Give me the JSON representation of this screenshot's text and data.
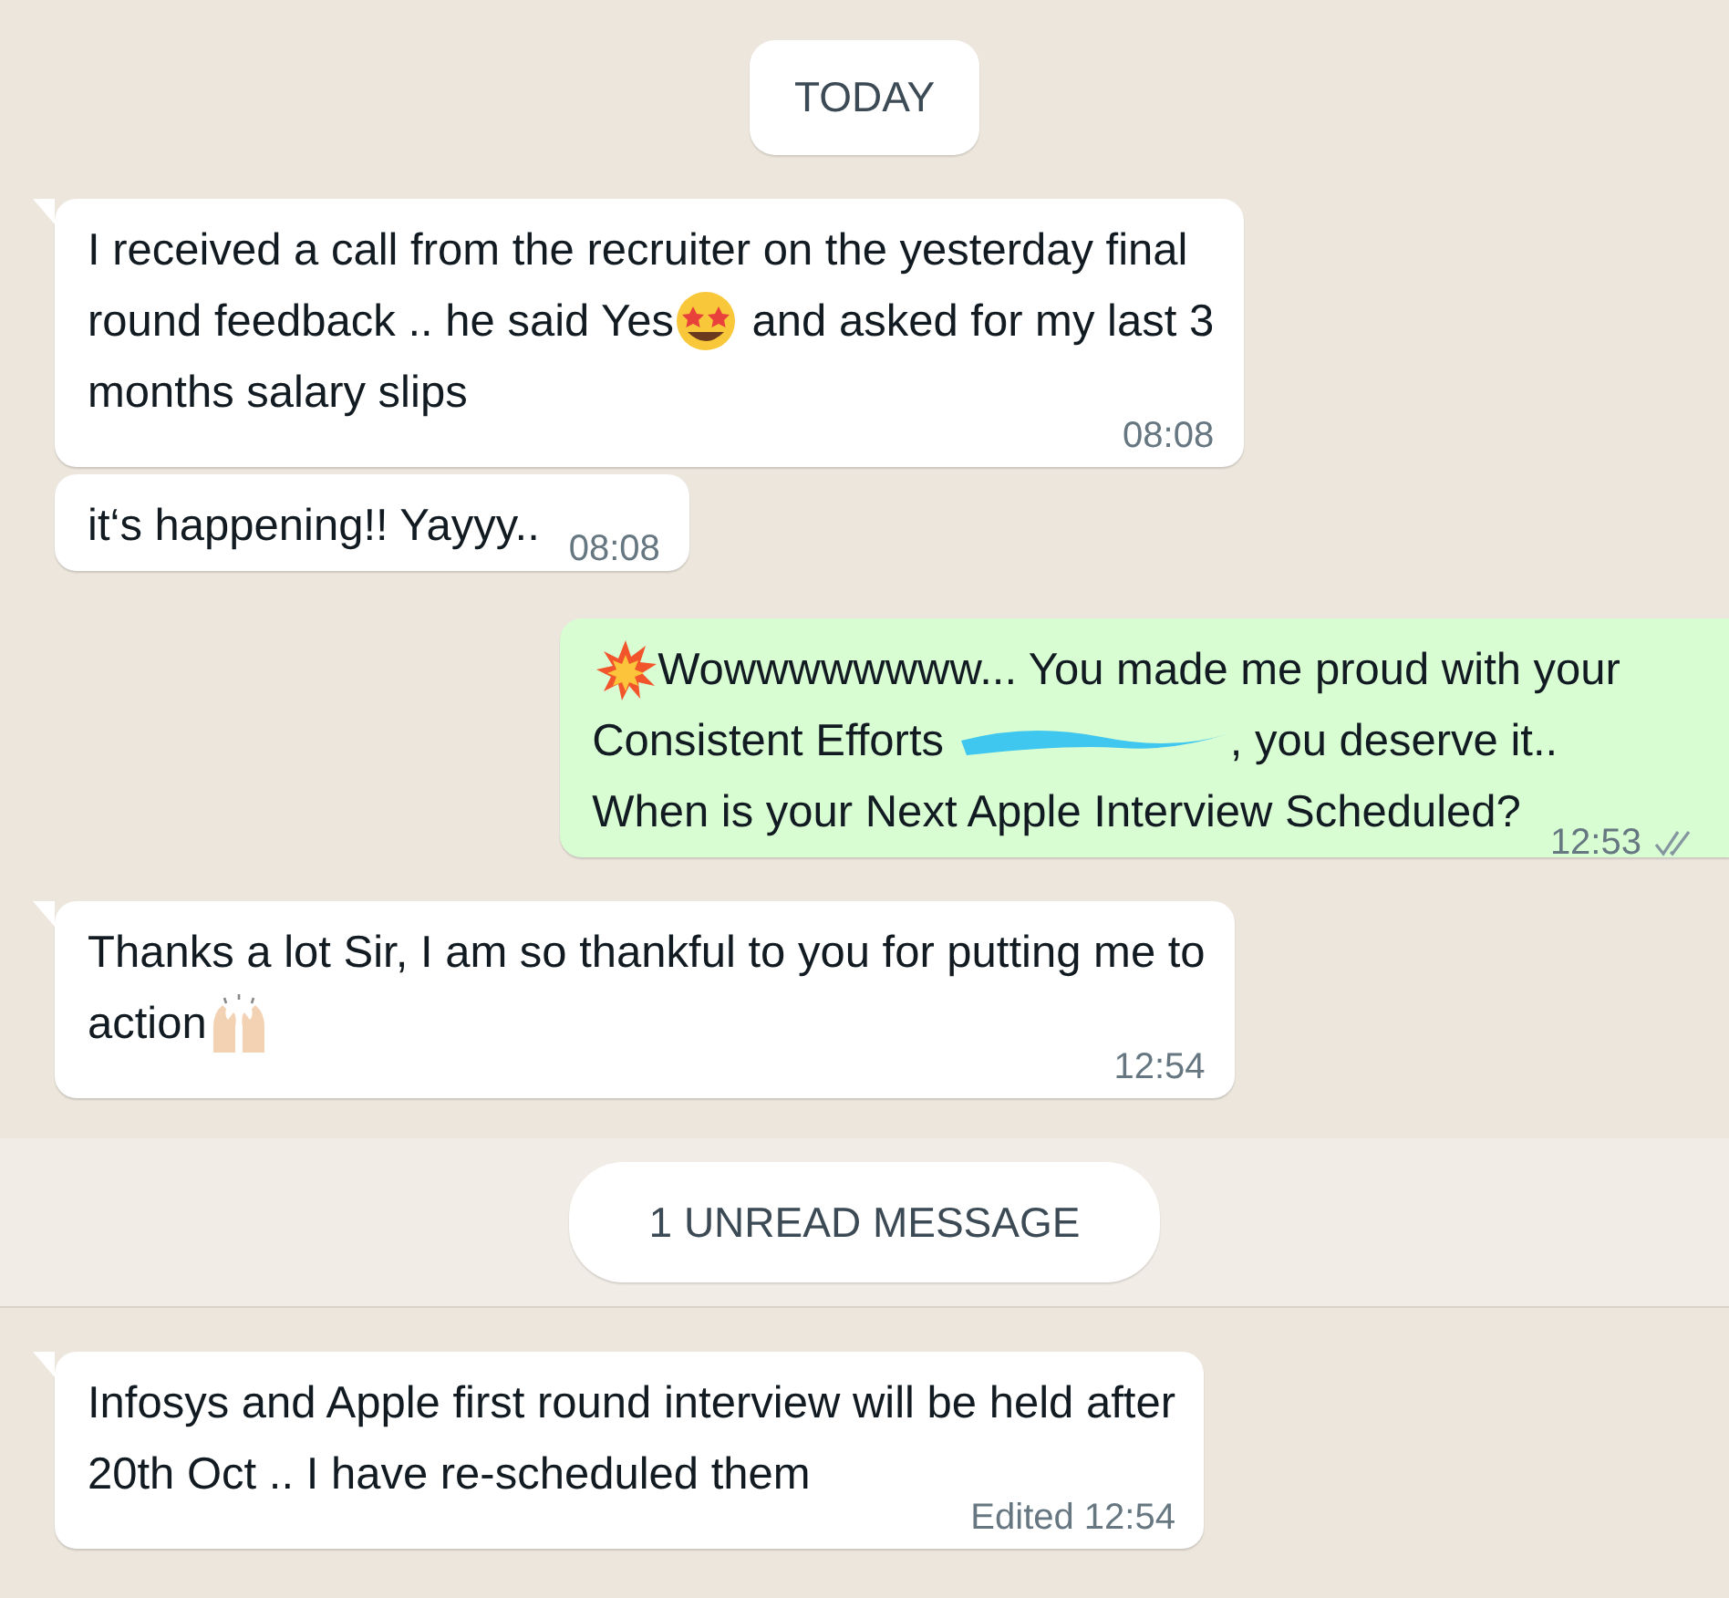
{
  "date_pill": "TODAY",
  "messages": [
    {
      "kind": "incoming",
      "tail": true,
      "lines": [
        [
          {
            "kind": "text",
            "text": "I received a call from the recruiter on the yesterday final"
          }
        ],
        [
          {
            "kind": "text",
            "text": "round feedback .. he said Yes"
          },
          {
            "kind": "star-face"
          },
          {
            "kind": "text",
            "text": " and asked for my last 3"
          }
        ],
        [
          {
            "kind": "text",
            "text": "months salary slips"
          }
        ]
      ],
      "time": "08:08",
      "inline_time": false
    },
    {
      "kind": "incoming",
      "tail": false,
      "lines": [
        [
          {
            "kind": "text",
            "text": "it‘s happening!! Yayyy.."
          }
        ]
      ],
      "time": "08:08",
      "inline_time": true
    },
    {
      "kind": "outgoing",
      "tail": false,
      "lines": [
        [
          {
            "kind": "burst"
          },
          {
            "kind": "text",
            "text": "Wowwwwwwww... You made me proud with your"
          }
        ],
        [
          {
            "kind": "text",
            "text": "Consistent Efforts "
          },
          {
            "kind": "redaction"
          },
          {
            "kind": "text",
            "text": ", you deserve it.."
          }
        ],
        [
          {
            "kind": "text",
            "text": "When is your Next Apple Interview Scheduled?"
          }
        ]
      ],
      "time": "12:53",
      "inline_time": true,
      "read": false
    },
    {
      "kind": "incoming",
      "tail": true,
      "lines": [
        [
          {
            "kind": "text",
            "text": "Thanks a lot Sir, I am so thankful to you for putting me to"
          }
        ],
        [
          {
            "kind": "text",
            "text": "action"
          },
          {
            "kind": "hands"
          }
        ]
      ],
      "time": "12:54",
      "inline_time": false
    }
  ],
  "unread_pill": "1 UNREAD MESSAGE",
  "unread_messages": [
    {
      "kind": "incoming",
      "tail": true,
      "lines": [
        [
          {
            "kind": "text",
            "text": "Infosys and Apple first round interview will be held after"
          }
        ],
        [
          {
            "kind": "text",
            "text": "20th Oct .. I have re-scheduled them"
          }
        ]
      ],
      "time": "Edited 12:54",
      "inline_time": false
    }
  ]
}
